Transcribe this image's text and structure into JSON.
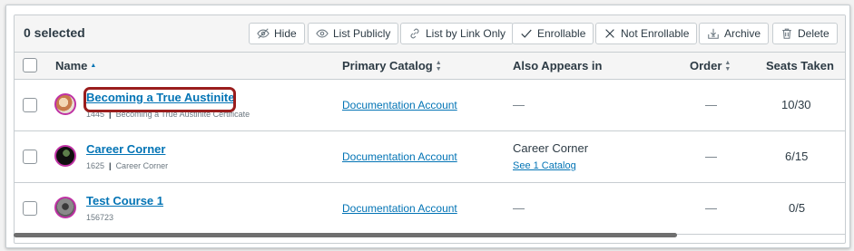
{
  "toolbar": {
    "selected_count": "0 selected",
    "buttons": [
      {
        "label": "Hide",
        "icon": "eye-slash-icon"
      },
      {
        "label": "List Publicly",
        "icon": "eye-icon"
      },
      {
        "label": "List by Link Only",
        "icon": "link-icon"
      },
      {
        "label": "Enrollable",
        "icon": "check-icon"
      },
      {
        "label": "Not Enrollable",
        "icon": "x-icon"
      },
      {
        "label": "Archive",
        "icon": "archive-icon"
      },
      {
        "label": "Delete",
        "icon": "trash-icon"
      }
    ]
  },
  "columns": {
    "name": "Name",
    "primary_catalog": "Primary Catalog",
    "also_appears": "Also Appears in",
    "order": "Order",
    "seats": "Seats Taken"
  },
  "rows": [
    {
      "title": "Becoming a True Austinite",
      "id": "1445",
      "subtitle": "Becoming a True Austinite Certificate",
      "primary_catalog": "Documentation Account",
      "also_appears": "—",
      "also_link": "",
      "order": "—",
      "seats": "10/30"
    },
    {
      "title": "Career Corner",
      "id": "1625",
      "subtitle": "Career Corner",
      "primary_catalog": "Documentation Account",
      "also_appears": "Career Corner",
      "also_link": "See 1 Catalog",
      "order": "—",
      "seats": "6/15"
    },
    {
      "title": "Test Course 1",
      "id": "156723",
      "subtitle": "",
      "primary_catalog": "Documentation Account",
      "also_appears": "—",
      "also_link": "",
      "order": "—",
      "seats": "0/5"
    }
  ],
  "colors": {
    "link": "#0374b5",
    "highlight": "#9a1d1d",
    "avatar_border": "#bf32a4"
  }
}
